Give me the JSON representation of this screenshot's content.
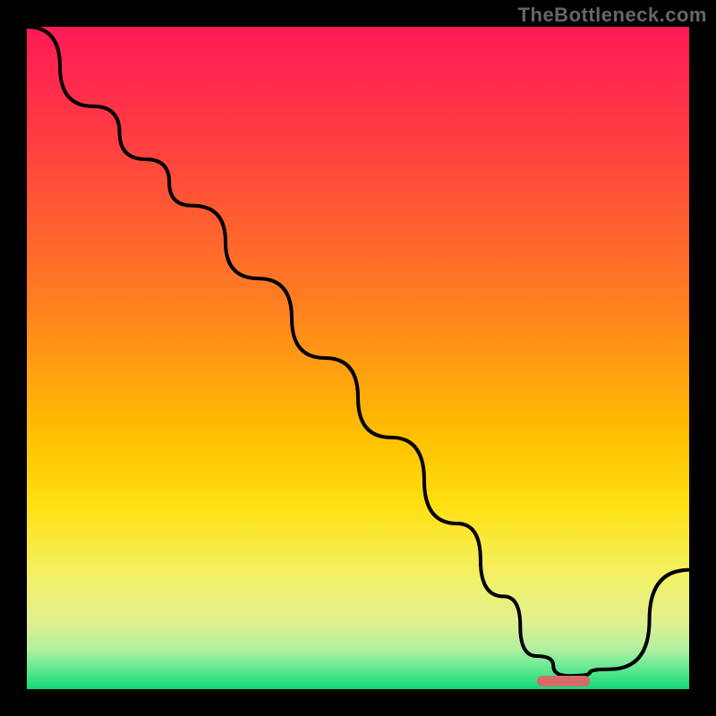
{
  "watermark": "TheBottleneck.com",
  "colors": {
    "background": "#000000",
    "curve": "#000000",
    "marker": "#d86a6a",
    "gradient_top": "#ff1a55",
    "gradient_mid": "#ffe010",
    "gradient_bottom": "#10d878"
  },
  "chart_data": {
    "type": "line",
    "title": "",
    "xlabel": "",
    "ylabel": "",
    "xlim": [
      0,
      100
    ],
    "ylim": [
      0,
      100
    ],
    "grid": false,
    "series": [
      {
        "name": "bottleneck_curve",
        "x": [
          0,
          10,
          18,
          25,
          35,
          45,
          55,
          65,
          72,
          77,
          82,
          88,
          100
        ],
        "values": [
          100,
          88,
          80,
          73,
          62,
          50,
          38,
          25,
          14,
          5,
          2,
          3,
          18
        ]
      }
    ],
    "annotations": [
      {
        "name": "optimal_range_marker",
        "x_start": 77,
        "x_end": 85,
        "y": 1.2
      }
    ],
    "legend": false
  }
}
